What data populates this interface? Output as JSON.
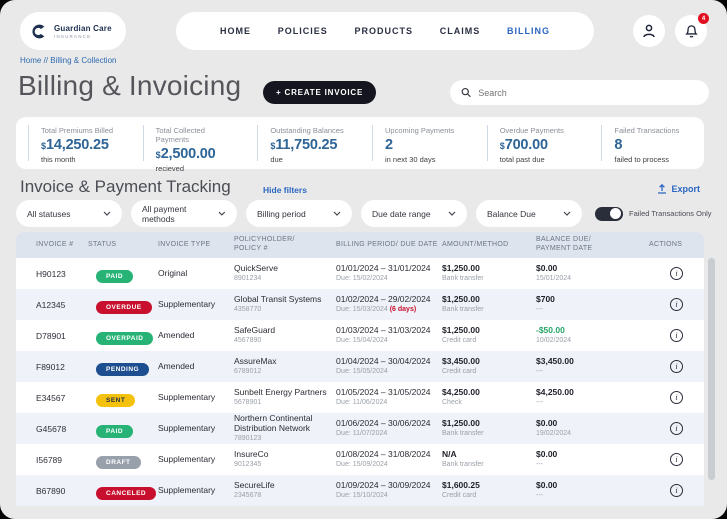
{
  "brand": {
    "name": "Guardian Care",
    "sub": "INSURANCE"
  },
  "nav": {
    "items": [
      {
        "label": "HOME",
        "active": false
      },
      {
        "label": "POLICIES",
        "active": false
      },
      {
        "label": "PRODUCTS",
        "active": false
      },
      {
        "label": "CLAIMS",
        "active": false
      },
      {
        "label": "BILLING",
        "active": true
      }
    ],
    "notification_count": "4"
  },
  "breadcrumb": "Home // Billing & Collection",
  "page": {
    "title": "Billing & Invoicing",
    "create_button": "+ CREATE INVOICE",
    "search_placeholder": "Search"
  },
  "stats": [
    {
      "label": "Total Premiums Billed",
      "currency": "$",
      "value": "14,250.25",
      "sub": "this month"
    },
    {
      "label": "Total Collected Payments",
      "currency": "$",
      "value": "2,500.00",
      "sub": "recieved"
    },
    {
      "label": "Outstanding Balances",
      "currency": "$",
      "value": "11,750.25",
      "sub": "due"
    },
    {
      "label": "Upcoming Payments",
      "currency": "",
      "value": "2",
      "sub": "in next 30 days"
    },
    {
      "label": "Overdue Payments",
      "currency": "$",
      "value": "700.00",
      "sub": "total past due"
    },
    {
      "label": "Failed Transactions",
      "currency": "",
      "value": "8",
      "sub": "failed to process"
    }
  ],
  "tracking": {
    "title": "Invoice & Payment Tracking",
    "hide_filters": "Hide filters",
    "export_label": "Export",
    "filters": [
      "All statuses",
      "All payment methods",
      "Billing period",
      "Due date range",
      "Balance Due"
    ],
    "toggle_label": "Failed Transactions Only",
    "toggle_on": true
  },
  "colors": {
    "accent_blue": "#2b66c2",
    "value_blue": "#2e6496",
    "overdue_red": "#c8102e",
    "credit_green": "#27a567"
  },
  "table": {
    "headers": [
      "INVOICE #",
      "STATUS",
      "INVOICE TYPE",
      "POLICYHOLDER/\nPOLICY #",
      "BILLING PERIOD/ DUE DATE",
      "AMOUNT/METHOD",
      "BALANCE DUE/\nPAYMENT DATE",
      "ACTIONS"
    ],
    "rows": [
      {
        "invoice": "H90123",
        "status": {
          "label": "PAID",
          "bg": "#27b376",
          "fg": "#ffffff"
        },
        "type": "Original",
        "policyholder": "QuickServe",
        "policy": "8901234",
        "period": "01/01/2024 – 31/01/2024",
        "due": "Due: 15/02/2024",
        "due_note": "",
        "amount": "$1,250.00",
        "method": "Bank transfer",
        "balance": "$0.00",
        "balance_color": "",
        "payment_date": "15/01/2024"
      },
      {
        "invoice": "A12345",
        "status": {
          "label": "OVERDUE",
          "bg": "#c8102e",
          "fg": "#ffffff"
        },
        "type": "Supplementary",
        "policyholder": "Global Transit Systems",
        "policy": "4358770",
        "period": "01/02/2024 – 29/02/2024",
        "due": "Due: 15/03/2024",
        "due_note": "(6 days)",
        "amount": "$1,250.00",
        "method": "Bank transfer",
        "balance": "$700",
        "balance_color": "",
        "payment_date": "---"
      },
      {
        "invoice": "D78901",
        "status": {
          "label": "OVERPAID",
          "bg": "#27b376",
          "fg": "#ffffff"
        },
        "type": "Amended",
        "policyholder": "SafeGuard",
        "policy": "4567890",
        "period": "01/03/2024 – 31/03/2024",
        "due": "Due: 15/04/2024",
        "due_note": "",
        "amount": "$1,250.00",
        "method": "Credit card",
        "balance": "-$50.00",
        "balance_color": "#27a567",
        "payment_date": "10/02/2024"
      },
      {
        "invoice": "F89012",
        "status": {
          "label": "PENDING",
          "bg": "#1d4e8f",
          "fg": "#ffffff"
        },
        "type": "Amended",
        "policyholder": "AssureMax",
        "policy": "6789012",
        "period": "01/04/2024 – 30/04/2024",
        "due": "Due: 15/05/2024",
        "due_note": "",
        "amount": "$3,450.00",
        "method": "Credit card",
        "balance": "$3,450.00",
        "balance_color": "",
        "payment_date": "---"
      },
      {
        "invoice": "E34567",
        "status": {
          "label": "SENT",
          "bg": "#f4c20d",
          "fg": "#1d2b4f"
        },
        "type": "Supplementary",
        "policyholder": "Sunbelt Energy Partners",
        "policy": "5678901",
        "period": "01/05/2024 – 31/05/2024",
        "due": "Due: 11/06/2024",
        "due_note": "",
        "amount": "$4,250.00",
        "method": "Check",
        "balance": "$4,250.00",
        "balance_color": "",
        "payment_date": "---"
      },
      {
        "invoice": "G45678",
        "status": {
          "label": "PAID",
          "bg": "#27b376",
          "fg": "#ffffff"
        },
        "type": "Supplementary",
        "policyholder": "Northern Continental Distribution Network",
        "policy": "7890123",
        "period": "01/06/2024 – 30/06/2024",
        "due": "Due: 11/07/2024",
        "due_note": "",
        "amount": "$1,250.00",
        "method": "Bank transfer",
        "balance": "$0.00",
        "balance_color": "",
        "payment_date": "19/02/2024"
      },
      {
        "invoice": "I56789",
        "status": {
          "label": "DRAFT",
          "bg": "#97a0ab",
          "fg": "#ffffff"
        },
        "type": "Supplementary",
        "policyholder": "InsureCo",
        "policy": "9012345",
        "period": "01/08/2024 – 31/08/2024",
        "due": "Due: 15/09/2024",
        "due_note": "",
        "amount": "N/A",
        "method": "Bank transfer",
        "balance": "$0.00",
        "balance_color": "",
        "payment_date": "---"
      },
      {
        "invoice": "B67890",
        "status": {
          "label": "CANCELED",
          "bg": "#c8102e",
          "fg": "#ffffff"
        },
        "type": "Supplementary",
        "policyholder": "SecureLife",
        "policy": "2345678",
        "period": "01/09/2024 – 30/09/2024",
        "due": "Due: 15/10/2024",
        "due_note": "",
        "amount": "$1,600.25",
        "method": "Credit card",
        "balance": "$0.00",
        "balance_color": "",
        "payment_date": "---"
      }
    ]
  }
}
